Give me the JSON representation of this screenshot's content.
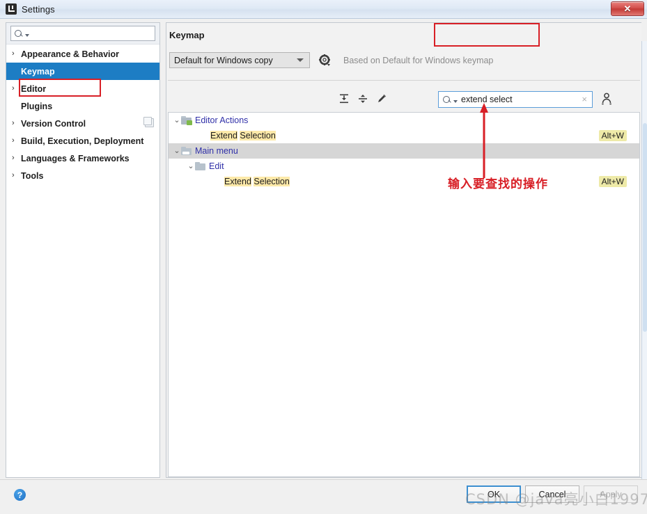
{
  "window": {
    "title": "Settings",
    "app_icon": "intellij-idea-icon",
    "close_label": "✕"
  },
  "sidebar": {
    "search": {
      "placeholder": "",
      "value": "",
      "icon": "search-icon"
    },
    "items": [
      {
        "label": "Appearance & Behavior",
        "expandable": true,
        "selected": false
      },
      {
        "label": "Keymap",
        "expandable": false,
        "selected": true
      },
      {
        "label": "Editor",
        "expandable": true,
        "selected": false
      },
      {
        "label": "Plugins",
        "expandable": false,
        "selected": false
      },
      {
        "label": "Version Control",
        "expandable": true,
        "selected": false,
        "trailing_icon": "copy-icon"
      },
      {
        "label": "Build, Execution, Deployment",
        "expandable": true,
        "selected": false
      },
      {
        "label": "Languages & Frameworks",
        "expandable": true,
        "selected": false
      },
      {
        "label": "Tools",
        "expandable": true,
        "selected": false
      }
    ],
    "arrow_glyph": "›"
  },
  "main": {
    "title": "Keymap",
    "keymap_select": {
      "value": "Default for Windows copy"
    },
    "gear_icon": "gear-icon",
    "based_on": "Based on Default for Windows keymap",
    "toolbar": {
      "expand_all": "expand-all-icon",
      "collapse_all": "collapse-all-icon",
      "edit": "pencil-edit-icon"
    },
    "find": {
      "value": "extend select",
      "placeholder": "",
      "search_icon": "search-icon",
      "clear_label": "×",
      "find_by_shortcut_icon": "find-by-shortcut-icon"
    },
    "tree": [
      {
        "label": "Editor Actions",
        "indent": 0,
        "type": "group",
        "twisty": "⌄",
        "icon": "editor-actions-folder-icon",
        "selected": false
      },
      {
        "label": "Extend Selection",
        "indent": 2,
        "type": "action",
        "twisty": "",
        "icon": "",
        "selected": false,
        "highlight": [
          {
            "text": "Extend",
            "hl": true
          },
          {
            "text": " ",
            "hl": false
          },
          {
            "text": "Selection",
            "hl": true
          }
        ],
        "shortcut": "Alt+W"
      },
      {
        "label": "Main menu",
        "indent": 0,
        "type": "group",
        "twisty": "⌄",
        "icon": "main-menu-folder-icon",
        "selected": true
      },
      {
        "label": "Edit",
        "indent": 1,
        "type": "group",
        "twisty": "⌄",
        "icon": "folder-icon",
        "selected": false
      },
      {
        "label": "Extend Selection",
        "indent": 3,
        "type": "action",
        "twisty": "",
        "icon": "",
        "selected": false,
        "highlight": [
          {
            "text": "Extend",
            "hl": true
          },
          {
            "text": " ",
            "hl": false
          },
          {
            "text": "Selection",
            "hl": true
          }
        ],
        "shortcut": "Alt+W"
      }
    ]
  },
  "annotations": {
    "arrow": "up-arrow-annotation",
    "text": "输入要查找的操作",
    "color": "#d81f26"
  },
  "footer": {
    "help_label": "?",
    "ok_label": "OK",
    "cancel_label": "Cancel",
    "apply_label": "Apply"
  },
  "watermark": "CSDN @java亮小白1997"
}
